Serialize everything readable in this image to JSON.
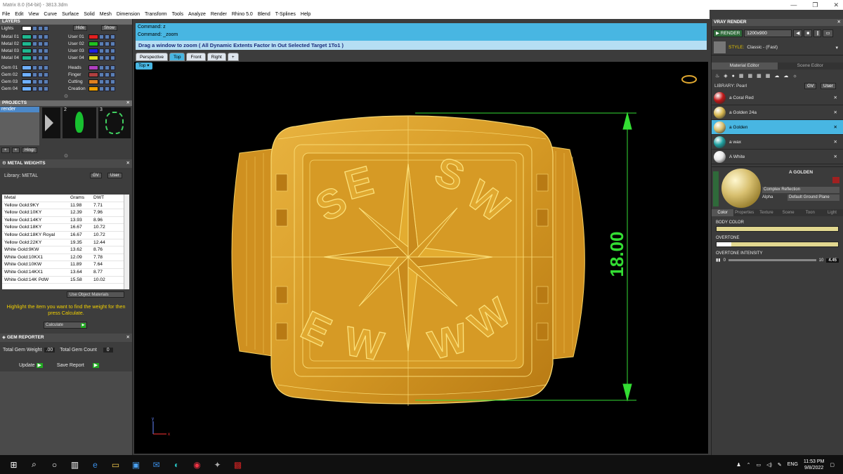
{
  "title": "Matrix 8.0 (64-bit) - 3813.3dm",
  "menu": [
    "File",
    "Edit",
    "View",
    "Curve",
    "Surface",
    "Solid",
    "Mesh",
    "Dimension",
    "Transform",
    "Tools",
    "Analyze",
    "Render",
    "Rhino 5.0",
    "Blend",
    "T-Splines",
    "Help"
  ],
  "layers": {
    "header": "LAYERS",
    "hide": "Hide",
    "show": "Show",
    "left": [
      {
        "n": "Lights",
        "c": "#ffffff"
      },
      {
        "n": "Metal 01",
        "c": "#1fb890"
      },
      {
        "n": "Metal 02",
        "c": "#1fb890"
      },
      {
        "n": "Metal 03",
        "c": "#1fb890"
      },
      {
        "n": "Metal 04",
        "c": "#1fb890"
      },
      {
        "n": "Gem 01",
        "c": "#6fb0ff"
      },
      {
        "n": "Gem 02",
        "c": "#6fb0ff"
      },
      {
        "n": "Gem 03",
        "c": "#6fb0ff"
      },
      {
        "n": "Gem 04",
        "c": "#6fb0ff"
      }
    ],
    "right": [
      {
        "n": "User 01",
        "c": "#e02020"
      },
      {
        "n": "User 02",
        "c": "#20c020"
      },
      {
        "n": "User 03",
        "c": "#2020e0"
      },
      {
        "n": "User 04",
        "c": "#e0e020"
      },
      {
        "n": "Heads",
        "c": "#b040c0"
      },
      {
        "n": "Finger",
        "c": "#b04040"
      },
      {
        "n": "Cutting",
        "c": "#e08020"
      },
      {
        "n": "Creation",
        "c": "#f0a000"
      }
    ]
  },
  "projects": {
    "header": "PROJECTS",
    "item": "render",
    "thumb2": "2",
    "thumb3": "3",
    "hinge": "Hingr"
  },
  "metal": {
    "header": "METAL WEIGHTS",
    "library": "Library: METAL",
    "gv": "GV",
    "user": "User",
    "cols": [
      "Metal",
      "Grams",
      "DWT"
    ],
    "rows": [
      [
        "Yellow Gold:9KY",
        "11.98",
        "7.71"
      ],
      [
        "Yellow Gold:10KY",
        "12.39",
        "7.96"
      ],
      [
        "Yellow Gold:14KY",
        "13.93",
        "8.96"
      ],
      [
        "Yellow Gold:18KY",
        "16.67",
        "10.72"
      ],
      [
        "Yellow Gold:18KY Royal",
        "16.67",
        "10.72"
      ],
      [
        "Yellow Gold:22KY",
        "19.35",
        "12.44"
      ],
      [
        "White Gold:9KW",
        "13.62",
        "8.76"
      ],
      [
        "White Gold:10KX1",
        "12.09",
        "7.78"
      ],
      [
        "White Gold:10KW",
        "11.89",
        "7.64"
      ],
      [
        "White Gold:14KX1",
        "13.64",
        "8.77"
      ],
      [
        "White Gold:14K PdW",
        "15.58",
        "10.02"
      ]
    ],
    "useObj": "Use Object Materials",
    "hint": "Highlight the item you want to find the weight for then press Calculate.",
    "calc": "Calculate"
  },
  "gem": {
    "header": "GEM REPORTER",
    "tw": "Total Gem Weight",
    "twv": ".00",
    "tc": "Total Gem Count",
    "tcv": "0",
    "update": "Update",
    "save": "Save Report"
  },
  "command": {
    "l1": "Command: z",
    "l2": "Command: _zoom",
    "prompt": "Drag a window to zoom ( All  Dynamic  Extents  Factor  In  Out  Selected  Target  1To1 )"
  },
  "tabs": [
    "Perspective",
    "Top",
    "Front",
    "Right",
    "+"
  ],
  "viewlabel": "Top",
  "dimension": "18.00",
  "axis": {
    "y": "y",
    "x": "x"
  },
  "vray": {
    "header": "VRAY RENDER",
    "render": "RENDER",
    "size": "1200x900",
    "style": "STYLE:",
    "styleval": "Classic - (Fast)",
    "tabs": [
      "Material Editor",
      "Scene Editor"
    ],
    "library": "LIBRARY: Pearl",
    "gv": "GV",
    "user": "User",
    "mats": [
      {
        "n": "a Coral Red",
        "c": "#c01818"
      },
      {
        "n": "a Golden 24a",
        "c": "#d8b850"
      },
      {
        "n": "a Golden",
        "c": "#d8c070"
      },
      {
        "n": "a wax",
        "c": "#20a0a0"
      },
      {
        "n": "A White",
        "c": "#e8e8e8"
      }
    ],
    "selname": "A GOLDEN",
    "complex": "Complex Reflection",
    "alpha": "Alpha",
    "ground": "Default Ground Plane",
    "proptabs": [
      "Color",
      "Properties",
      "Texture",
      "Scene",
      "Toon",
      "Light"
    ],
    "body": "BODY COLOR",
    "over": "OVERTONE",
    "intensity": "OVERTONE INTENSITY",
    "i0": "0",
    "i10": "10",
    "ival": "4.45"
  },
  "taskbar": {
    "lang": "ENG",
    "time": "11:53 PM",
    "date": "9/8/2022"
  }
}
